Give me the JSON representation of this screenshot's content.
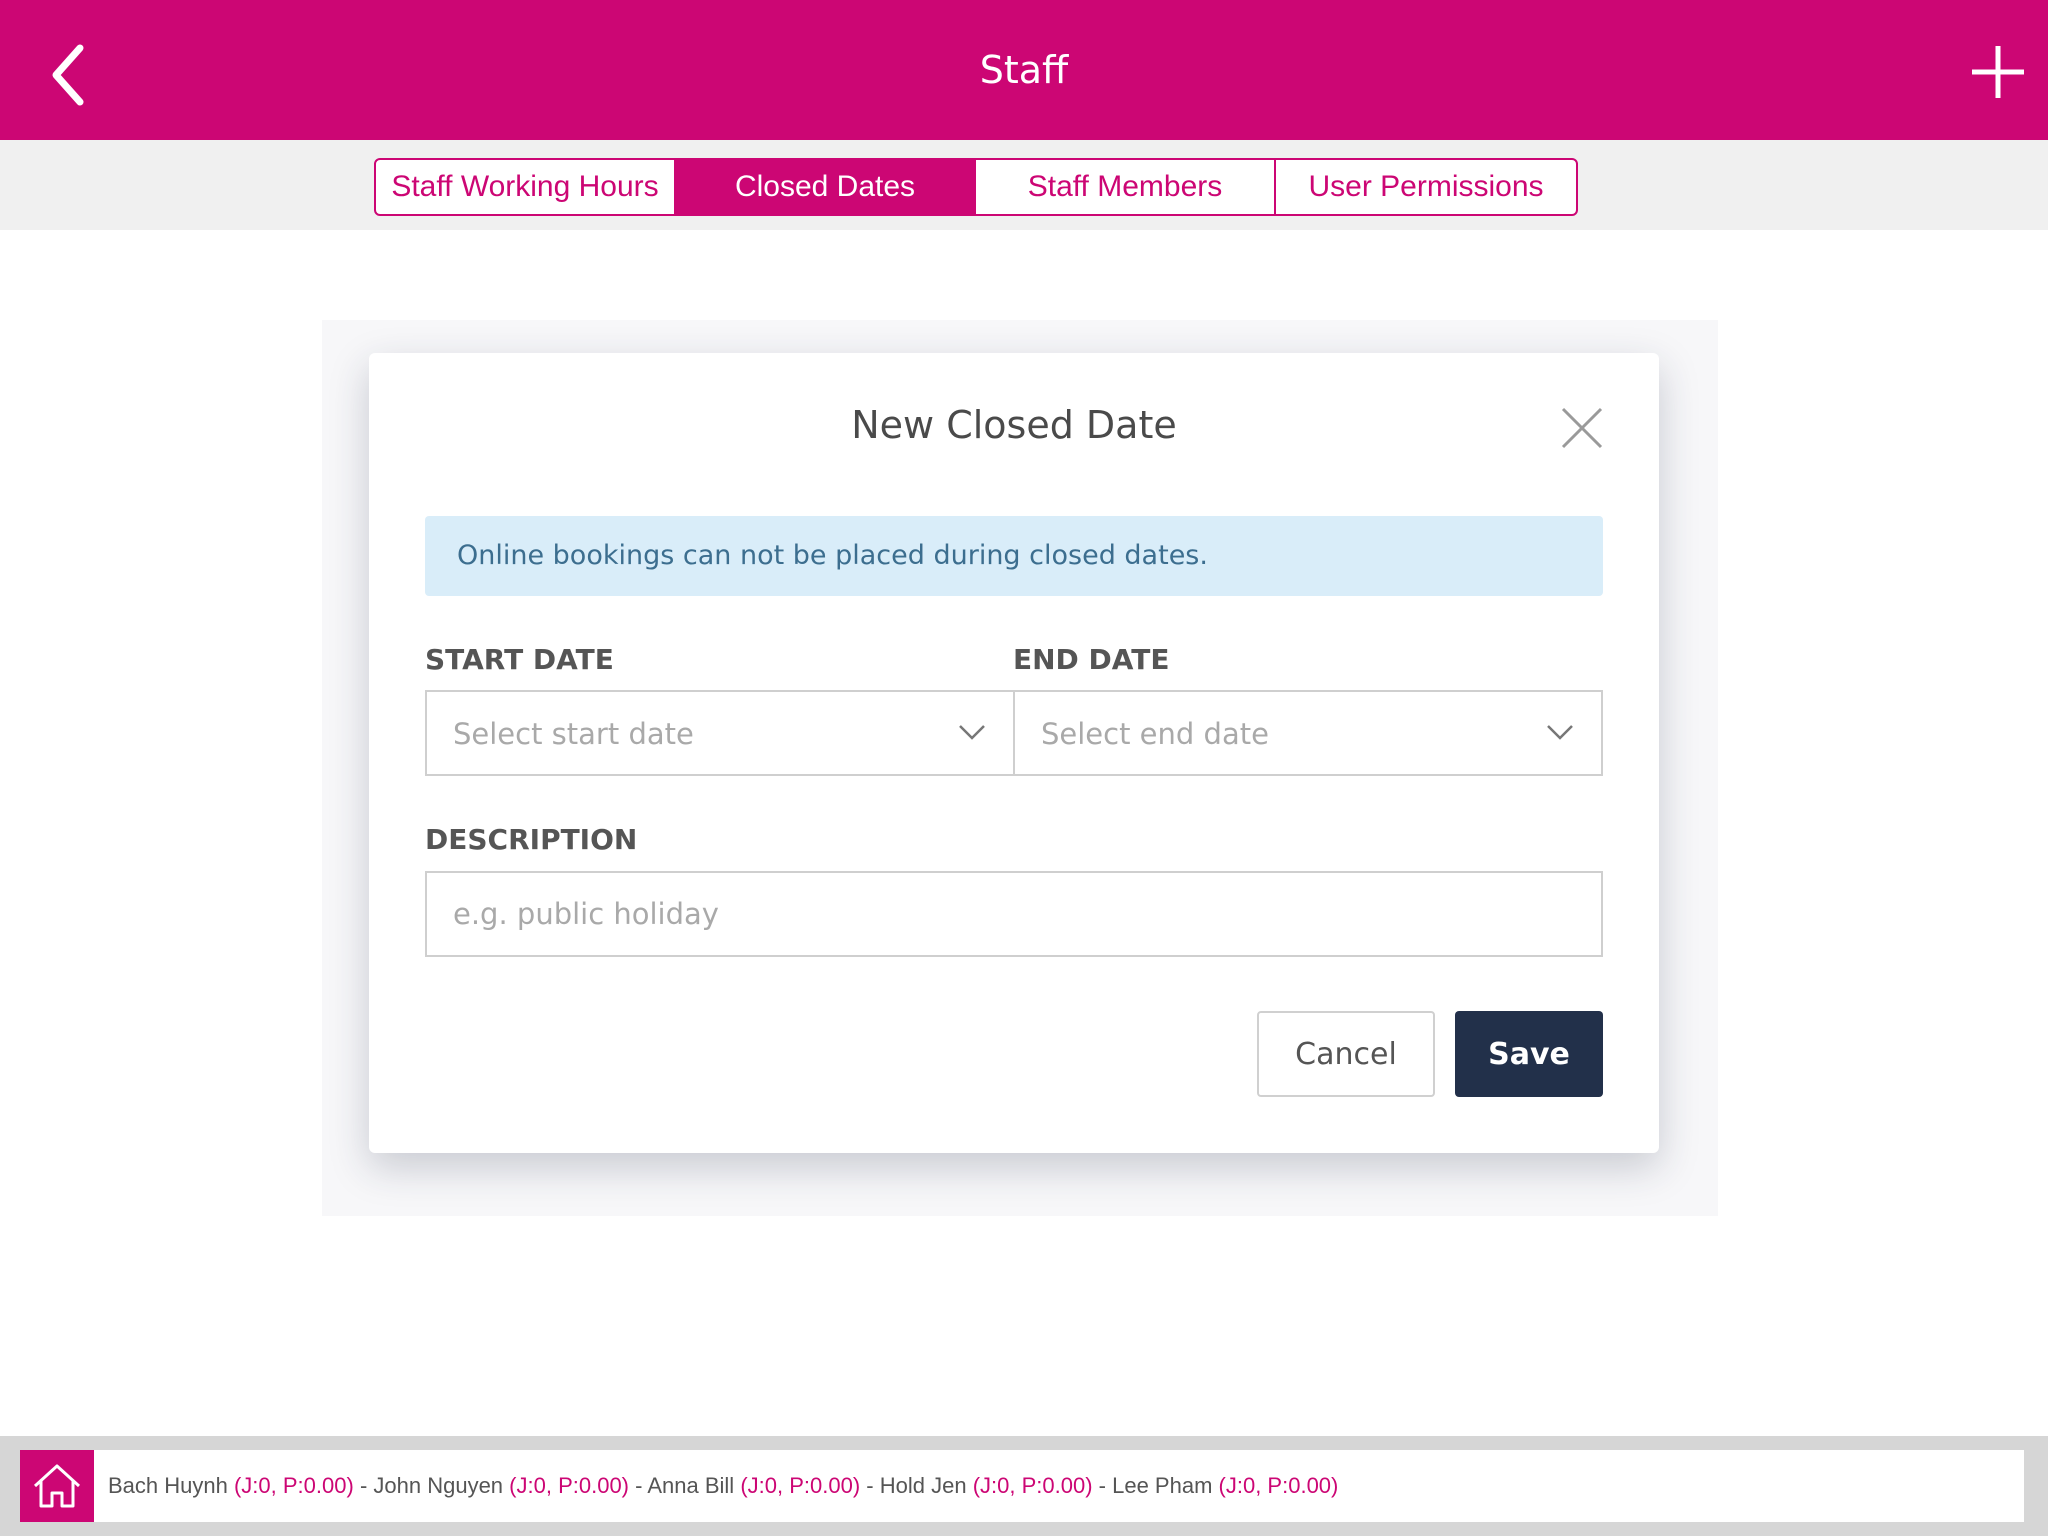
{
  "header": {
    "title": "Staff",
    "back_icon": "chevron-left-icon",
    "add_icon": "plus-icon",
    "brand_color": "#cc0674"
  },
  "tabs": [
    {
      "label": "Staff Working Hours",
      "active": false
    },
    {
      "label": "Closed Dates",
      "active": true
    },
    {
      "label": "Staff Members",
      "active": false
    },
    {
      "label": "User Permissions",
      "active": false
    }
  ],
  "modal": {
    "title": "New Closed Date",
    "close_icon": "close-icon",
    "info": "Online bookings can not be placed during closed dates.",
    "start_date": {
      "label": "START DATE",
      "placeholder": "Select start date"
    },
    "end_date": {
      "label": "END DATE",
      "placeholder": "Select end date"
    },
    "description": {
      "label": "DESCRIPTION",
      "placeholder": "e.g. public holiday",
      "value": ""
    },
    "cancel_label": "Cancel",
    "save_label": "Save"
  },
  "footer": {
    "home_icon": "home-icon",
    "separator": " - ",
    "staff": [
      {
        "name": "Bach Huynh",
        "stats": "(J:0, P:0.00)"
      },
      {
        "name": "John Nguyen",
        "stats": "(J:0, P:0.00)"
      },
      {
        "name": "Anna Bill",
        "stats": "(J:0, P:0.00)"
      },
      {
        "name": "Hold Jen",
        "stats": "(J:0, P:0.00)"
      },
      {
        "name": "Lee Pham",
        "stats": "(J:0, P:0.00)"
      }
    ]
  }
}
